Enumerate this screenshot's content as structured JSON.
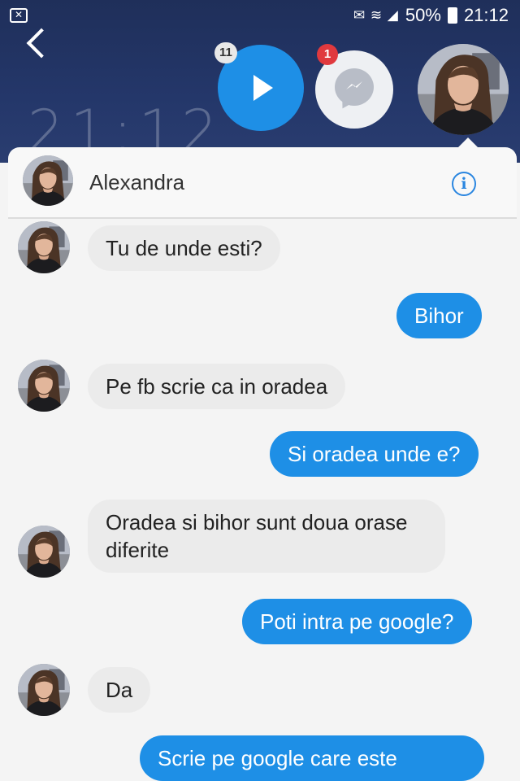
{
  "status_bar": {
    "battery": "50%",
    "time": "21:12"
  },
  "lockscreen_clock": "21:12",
  "chat_heads": {
    "video_badge": "11",
    "messenger_badge": "1"
  },
  "chat": {
    "contact_name": "Alexandra"
  },
  "messages": [
    {
      "from": "them",
      "text": "Tu de unde esti?"
    },
    {
      "from": "me",
      "text": "Bihor"
    },
    {
      "from": "them",
      "text": "Pe fb scrie ca in oradea"
    },
    {
      "from": "me",
      "text": "Si oradea unde e?"
    },
    {
      "from": "them",
      "text": "Oradea si bihor sunt doua orase diferite"
    },
    {
      "from": "me",
      "text": "Poti intra pe google?"
    },
    {
      "from": "them",
      "text": "Da"
    },
    {
      "from": "me",
      "text": "Scrie pe google care este"
    }
  ],
  "colors": {
    "outgoing": "#1e8fe6",
    "incoming": "#ebebeb",
    "accent": "#2a86e0"
  }
}
